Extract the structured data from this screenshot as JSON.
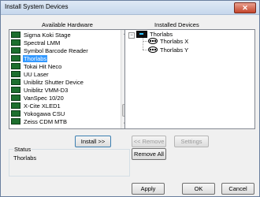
{
  "window": {
    "title": "Install System Devices",
    "close_glyph": "✕"
  },
  "available": {
    "header": "Available Hardware",
    "items": [
      "Sigma Koki Stage",
      "Spectral LMM",
      "Symbol Barcode Reader",
      "Thorlabs",
      "Tokai Hit Neco",
      "UU Laser",
      "Uniblitz Shutter Device",
      "Uniblitz VMM-D3",
      "VanSpec 10/20",
      "X-Cite XLED1",
      "Yokogawa CSU",
      "Zeiss CDM MTB"
    ],
    "selected_index": 3,
    "item_icon": "device-board-icon"
  },
  "installed": {
    "header": "Installed Devices",
    "root": {
      "label": "Thorlabs",
      "icon": "hub-icon",
      "expander": "−"
    },
    "children": [
      {
        "label": "Thorlabs X",
        "icon": "filter-wheel-icon"
      },
      {
        "label": "Thorlabs Y",
        "icon": "filter-wheel-icon"
      }
    ]
  },
  "buttons": {
    "install": "Install >>",
    "remove": "<< Remove",
    "settings": "Settings",
    "remove_all": "Remove All",
    "apply": "Apply",
    "ok": "OK",
    "cancel": "Cancel"
  },
  "status": {
    "label": "Status",
    "value": "Thorlabs"
  }
}
